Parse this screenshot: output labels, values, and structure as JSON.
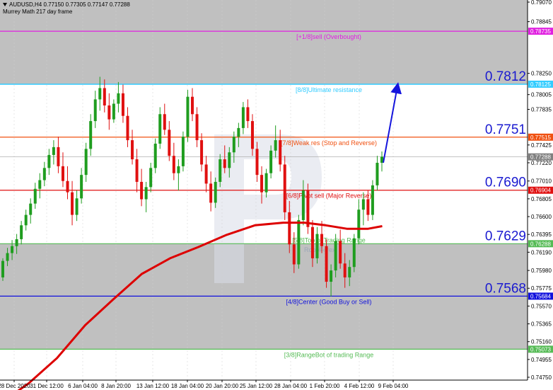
{
  "header": {
    "symbol_line": "AUDUSD,H4  0.77150 0.77305 0.77147 0.77288",
    "indicator_line": "Murrey Math 217 day frame"
  },
  "colors": {
    "shade": "#c0c0c0",
    "bull": "#1f9d1f",
    "bear": "#e01010",
    "ma": "#dd0000",
    "arrow": "#1515dd"
  },
  "chart_data": {
    "type": "candlestick",
    "symbol": "AUDUSD",
    "timeframe": "H4",
    "y_ticks": [
      0.7907,
      0.78845,
      0.7825,
      0.78005,
      0.77835,
      0.77425,
      0.7722,
      0.7701,
      0.76805,
      0.766,
      0.76395,
      0.7619,
      0.7598,
      0.75775,
      0.7557,
      0.75365,
      0.7516,
      0.74955,
      0.7475
    ],
    "x_ticks": [
      "28 Dec 2020",
      "31 Dec 12:00",
      "6 Jan 04:00",
      "8 Jan 20:00",
      "13 Jan 12:00",
      "18 Jan 04:00",
      "20 Jan 20:00",
      "25 Jan 12:00",
      "28 Jan 04:00",
      "1 Feb 20:00",
      "4 Feb 12:00",
      "9 Feb 04:00"
    ],
    "levels": [
      {
        "label": "[+1/8]sell (Overbought)",
        "value": 0.78735,
        "tag": "0.78735",
        "color": "#e020e0",
        "big": ""
      },
      {
        "label": "[8/8]Ultimate resistance",
        "value": 0.78125,
        "tag": "0.78125",
        "color": "#33ccff",
        "big": "0.7812"
      },
      {
        "label": "[7/8]Weak res (Stop and Reverse)",
        "value": 0.77515,
        "tag": "0.77515",
        "color": "#f05010",
        "big": "0.7751"
      },
      {
        "label": "[6/8]Pivot sell (Major Reverse)",
        "value": 0.76904,
        "tag": "0.76904",
        "color": "#e01010",
        "big": "0.7690"
      },
      {
        "label": "[5/8]Top of Trading Range",
        "value": 0.76288,
        "tag": "0.76288",
        "color": "#55bb55",
        "big": "0.7629"
      },
      {
        "label": "[4/8]Center (Good Buy or Sell)",
        "value": 0.75684,
        "tag": "0.75684",
        "color": "#1010dd",
        "big": "0.7568"
      },
      {
        "label": "[3/8]RangeBot of trading Range",
        "value": 0.75073,
        "tag": "0.75073",
        "color": "#55bb55",
        "big": ""
      }
    ],
    "current_price": 0.77288,
    "moving_average": [
      [
        0,
        0.7445
      ],
      [
        40,
        0.7468
      ],
      [
        80,
        0.7497
      ],
      [
        120,
        0.7535
      ],
      [
        160,
        0.7565
      ],
      [
        200,
        0.7594
      ],
      [
        240,
        0.7612
      ],
      [
        280,
        0.7625
      ],
      [
        320,
        0.7639
      ],
      [
        360,
        0.765
      ],
      [
        400,
        0.7653
      ],
      [
        430,
        0.7653
      ],
      [
        460,
        0.765
      ],
      [
        490,
        0.7646
      ],
      [
        520,
        0.7646
      ],
      [
        540,
        0.7649
      ]
    ],
    "candles": [
      [
        0.759,
        0.7612,
        0.7586,
        0.7609
      ],
      [
        0.7609,
        0.7624,
        0.7603,
        0.7618
      ],
      [
        0.7618,
        0.7633,
        0.761,
        0.7626
      ],
      [
        0.7626,
        0.764,
        0.7617,
        0.7634
      ],
      [
        0.7634,
        0.7655,
        0.7628,
        0.765
      ],
      [
        0.765,
        0.7668,
        0.7644,
        0.7662
      ],
      [
        0.7662,
        0.7681,
        0.7652,
        0.7675
      ],
      [
        0.7675,
        0.7699,
        0.7669,
        0.7692
      ],
      [
        0.7692,
        0.771,
        0.7681,
        0.7702
      ],
      [
        0.7702,
        0.7723,
        0.7695,
        0.7716
      ],
      [
        0.7716,
        0.7738,
        0.7708,
        0.7731
      ],
      [
        0.7731,
        0.7748,
        0.772,
        0.774
      ],
      [
        0.774,
        0.7752,
        0.771,
        0.7718
      ],
      [
        0.7718,
        0.7734,
        0.7694,
        0.7701
      ],
      [
        0.7701,
        0.7718,
        0.768,
        0.7688
      ],
      [
        0.7688,
        0.7701,
        0.765,
        0.7662
      ],
      [
        0.7662,
        0.769,
        0.7655,
        0.7681
      ],
      [
        0.7681,
        0.7716,
        0.7675,
        0.7708
      ],
      [
        0.7708,
        0.7745,
        0.77,
        0.7738
      ],
      [
        0.7738,
        0.7778,
        0.773,
        0.777
      ],
      [
        0.777,
        0.7805,
        0.7762,
        0.7795
      ],
      [
        0.7795,
        0.7821,
        0.7782,
        0.7808
      ],
      [
        0.7808,
        0.7818,
        0.778,
        0.7788
      ],
      [
        0.7788,
        0.7802,
        0.776,
        0.7772
      ],
      [
        0.7772,
        0.7795,
        0.7768,
        0.779
      ],
      [
        0.779,
        0.7815,
        0.778,
        0.7802
      ],
      [
        0.7802,
        0.7812,
        0.7768,
        0.7776
      ],
      [
        0.7776,
        0.7786,
        0.774,
        0.7748
      ],
      [
        0.7748,
        0.776,
        0.772,
        0.7726
      ],
      [
        0.7726,
        0.7738,
        0.7688,
        0.77
      ],
      [
        0.77,
        0.7715,
        0.7672,
        0.768
      ],
      [
        0.768,
        0.77,
        0.7665,
        0.7694
      ],
      [
        0.7694,
        0.7722,
        0.7688,
        0.7716
      ],
      [
        0.7716,
        0.775,
        0.771,
        0.7744
      ],
      [
        0.7744,
        0.7786,
        0.7738,
        0.7778
      ],
      [
        0.7778,
        0.779,
        0.7754,
        0.776
      ],
      [
        0.776,
        0.777,
        0.7724,
        0.773
      ],
      [
        0.773,
        0.7745,
        0.7702,
        0.771
      ],
      [
        0.771,
        0.7726,
        0.769,
        0.7718
      ],
      [
        0.7718,
        0.7758,
        0.7712,
        0.7752
      ],
      [
        0.7752,
        0.7806,
        0.7746,
        0.7798
      ],
      [
        0.7798,
        0.7808,
        0.777,
        0.7778
      ],
      [
        0.7778,
        0.7786,
        0.774,
        0.7748
      ],
      [
        0.7748,
        0.7756,
        0.7712,
        0.772
      ],
      [
        0.772,
        0.773,
        0.7688,
        0.7698
      ],
      [
        0.7698,
        0.7712,
        0.7666,
        0.7676
      ],
      [
        0.7676,
        0.7705,
        0.767,
        0.77
      ],
      [
        0.77,
        0.7732,
        0.7694,
        0.7726
      ],
      [
        0.7726,
        0.7742,
        0.771,
        0.7716
      ],
      [
        0.7716,
        0.774,
        0.7705,
        0.7734
      ],
      [
        0.7734,
        0.7758,
        0.7722,
        0.7752
      ],
      [
        0.7752,
        0.7768,
        0.774,
        0.7762
      ],
      [
        0.7762,
        0.7792,
        0.7755,
        0.7786
      ],
      [
        0.7786,
        0.7795,
        0.7762,
        0.777
      ],
      [
        0.777,
        0.7778,
        0.773,
        0.7738
      ],
      [
        0.7738,
        0.7746,
        0.77,
        0.7708
      ],
      [
        0.7708,
        0.7718,
        0.7675,
        0.7688
      ],
      [
        0.7688,
        0.7715,
        0.7682,
        0.771
      ],
      [
        0.771,
        0.7742,
        0.7704,
        0.7736
      ],
      [
        0.7736,
        0.7765,
        0.7728,
        0.7748
      ],
      [
        0.7748,
        0.776,
        0.7712,
        0.772
      ],
      [
        0.772,
        0.773,
        0.7656,
        0.7665
      ],
      [
        0.7665,
        0.7678,
        0.7618,
        0.7628
      ],
      [
        0.7628,
        0.7642,
        0.7595,
        0.7605
      ],
      [
        0.7605,
        0.7662,
        0.76,
        0.7656
      ],
      [
        0.7656,
        0.7702,
        0.765,
        0.769
      ],
      [
        0.769,
        0.7698,
        0.764,
        0.7648
      ],
      [
        0.7648,
        0.7656,
        0.7602,
        0.7612
      ],
      [
        0.7612,
        0.7648,
        0.7606,
        0.764
      ],
      [
        0.764,
        0.7655,
        0.7618,
        0.7626
      ],
      [
        0.7626,
        0.7634,
        0.7578,
        0.7585
      ],
      [
        0.7585,
        0.7605,
        0.7568,
        0.7598
      ],
      [
        0.7598,
        0.764,
        0.759,
        0.7632
      ],
      [
        0.7632,
        0.7645,
        0.76,
        0.7606
      ],
      [
        0.7606,
        0.7618,
        0.7578,
        0.759
      ],
      [
        0.759,
        0.761,
        0.758,
        0.7602
      ],
      [
        0.7602,
        0.764,
        0.7596,
        0.7635
      ],
      [
        0.7635,
        0.768,
        0.7628,
        0.7668
      ],
      [
        0.7668,
        0.7688,
        0.765,
        0.768
      ],
      [
        0.768,
        0.769,
        0.7655,
        0.7662
      ],
      [
        0.7662,
        0.7702,
        0.7656,
        0.7696
      ],
      [
        0.7696,
        0.773,
        0.769,
        0.7722
      ],
      [
        0.7722,
        0.7735,
        0.7712,
        0.7729
      ]
    ],
    "forecast_arrow": [
      [
        542,
        0.7722
      ],
      [
        562,
        0.781
      ]
    ]
  }
}
